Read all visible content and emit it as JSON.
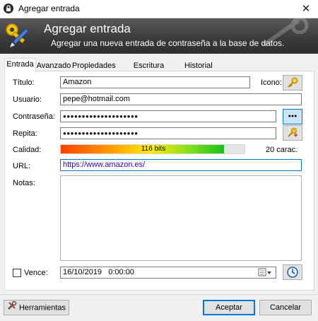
{
  "window": {
    "title": "Agregar entrada",
    "close_glyph": "✕"
  },
  "banner": {
    "title": "Agregar entrada",
    "subtitle": "Agregar una nueva entrada de contraseña a la base de datos."
  },
  "tabs": [
    {
      "label": "Entrada",
      "active": true
    },
    {
      "label": "Avanzado",
      "active": false
    },
    {
      "label": "Propiedades",
      "active": false
    },
    {
      "label": "Escritura automática",
      "active": false
    },
    {
      "label": "Historial",
      "active": false
    }
  ],
  "form": {
    "title_label": "Título:",
    "title_value": "Amazon",
    "icon_label": "Icono:",
    "user_label": "Usuario:",
    "user_value": "pepe@hotmail.com",
    "password_label": "Contraseña:",
    "password_value": "●●●●●●●●●●●●●●●●●●●●",
    "show_password_glyph": "●●●",
    "repeat_label": "Repita:",
    "repeat_value": "●●●●●●●●●●●●●●●●●●●●",
    "quality_label": "Calidad:",
    "quality_text": "116 bits",
    "quality_fraction": 0.89,
    "char_count": "20 carac.",
    "url_label": "URL:",
    "url_value": "https://www.amazon.es/",
    "notes_label": "Notas:",
    "expires_label": "Vence:",
    "expires_value": "16/10/2019   0:00:00"
  },
  "buttons": {
    "tools": "Herramientas",
    "accept": "Aceptar",
    "cancel": "Cancelar"
  },
  "colors": {
    "accent": "#0078d7",
    "banner": "#3b3b3b",
    "url_text": "#1a0dab"
  }
}
